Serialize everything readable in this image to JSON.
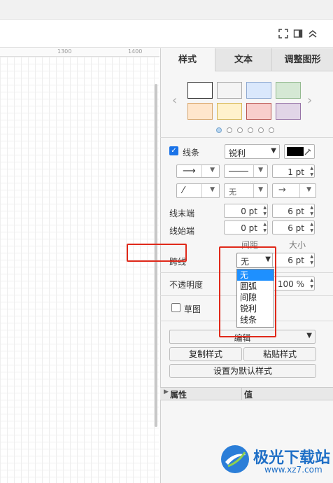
{
  "toolbar": {
    "icons": [
      "fullscreen-icon",
      "panel-toggle-icon",
      "collapse-up-icon"
    ]
  },
  "ruler": {
    "ticks": [
      "1300",
      "1400"
    ]
  },
  "tabs": [
    {
      "label": "样式"
    },
    {
      "label": "文本"
    },
    {
      "label": "调整图形"
    }
  ],
  "line": {
    "checkbox_label": "线条",
    "style_select": "锐利",
    "width": "1 pt",
    "end_label": "线末端",
    "start_label": "线始端",
    "end_spacing": "0 pt",
    "end_size": "6 pt",
    "start_spacing": "0 pt",
    "start_size": "6 pt",
    "spacing_col": "间距",
    "size_col": "大小",
    "pattern_select": "无",
    "arrow_select": "无",
    "jump_label": "跨线",
    "jump_select": "无",
    "jump_size": "6 pt"
  },
  "jump_dropdown": {
    "options": [
      "无",
      "圆弧",
      "间隙",
      "锐利",
      "线条"
    ],
    "selected": "无"
  },
  "opacity": {
    "label": "不透明度",
    "value": "100 %"
  },
  "sketch": {
    "label": "草图"
  },
  "edit": {
    "select_label": "编辑",
    "copy_style": "复制样式",
    "paste_style": "粘贴样式",
    "set_default": "设置为默认样式"
  },
  "properties": {
    "col_property": "属性",
    "col_value": "值"
  },
  "watermark": {
    "title": "极光下载站",
    "url": "www.xz7.com"
  },
  "colors": {
    "accent": "#1e90ff",
    "highlight_red": "#e0291a",
    "checkbox_blue": "#1a73e8"
  }
}
